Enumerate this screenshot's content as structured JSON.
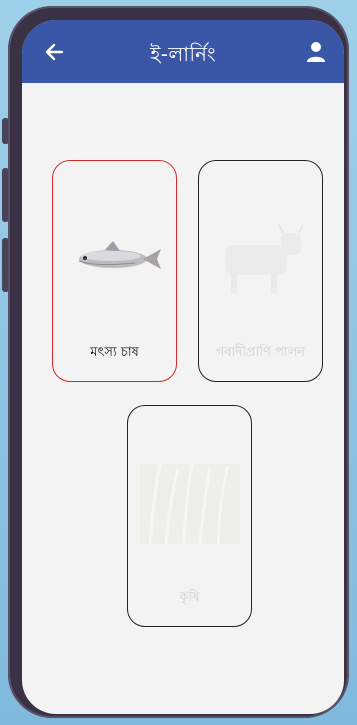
{
  "header": {
    "title": "ই-লার্নিং",
    "back_icon": "back-arrow-icon",
    "user_icon": "user-icon"
  },
  "categories": [
    {
      "label": "মৎস্য চাষ",
      "selected": true,
      "icon": "fish-image"
    },
    {
      "label": "গবাদীপ্রাণি পালন",
      "selected": false,
      "icon": "cattle-image"
    },
    {
      "label": "কৃষি",
      "selected": false,
      "icon": "crop-image"
    }
  ],
  "colors": {
    "header": "#3a56a6",
    "selected_border": "#d42a2a",
    "card_border": "#222222",
    "background": "#f3f3f3"
  }
}
